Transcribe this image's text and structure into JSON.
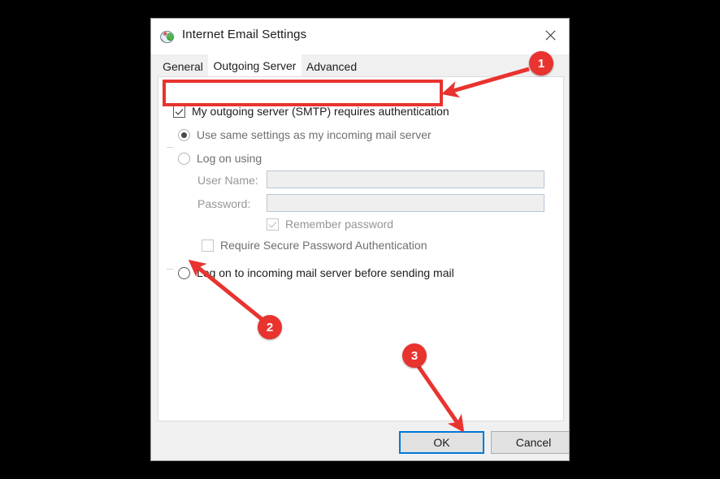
{
  "window": {
    "title": "Internet Email Settings",
    "icon": "email-settings-icon",
    "close_label": "close-icon"
  },
  "tabs": [
    {
      "label": "General",
      "active": false
    },
    {
      "label": "Outgoing Server",
      "active": true
    },
    {
      "label": "Advanced",
      "active": false
    }
  ],
  "form": {
    "smtp_auth": {
      "label": "My outgoing server (SMTP) requires authentication",
      "checked": true
    },
    "use_same_settings": {
      "label": "Use same settings as my incoming mail server",
      "selected": true
    },
    "log_on_using": {
      "label": "Log on using",
      "selected": false
    },
    "user_name": {
      "label": "User Name:",
      "value": "",
      "placeholder": ""
    },
    "password": {
      "label": "Password:",
      "value": "",
      "placeholder": ""
    },
    "remember_password": {
      "label": "Remember password",
      "checked": true
    },
    "require_spa": {
      "label": "Require Secure Password Authentication",
      "checked": false
    },
    "log_on_incoming": {
      "label": "Log on to incoming mail server before sending mail",
      "selected": false
    }
  },
  "buttons": {
    "ok": "OK",
    "cancel": "Cancel"
  },
  "annotations": {
    "markers": [
      {
        "number": "1"
      },
      {
        "number": "2"
      },
      {
        "number": "3"
      }
    ],
    "accent_color": "#e8332f"
  }
}
